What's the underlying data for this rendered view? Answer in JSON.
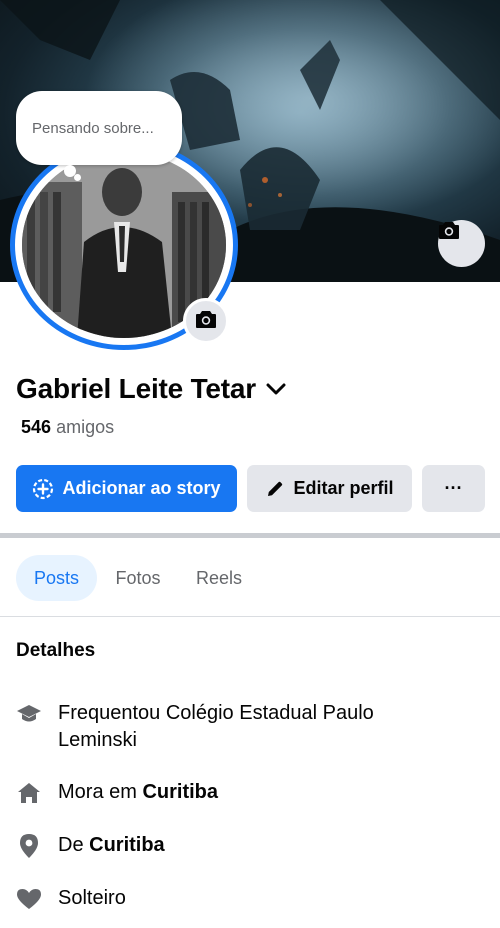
{
  "cover": {
    "camera_icon": "camera-icon"
  },
  "avatar": {
    "camera_icon": "camera-icon"
  },
  "bubble": {
    "text": "Pensando sobre..."
  },
  "profile": {
    "name": "Gabriel Leite Tetar",
    "friends_count": "546",
    "friends_label": "amigos"
  },
  "actions": {
    "add_story": "Adicionar ao story",
    "edit_profile": "Editar perfil",
    "more": "···"
  },
  "tabs": [
    {
      "label": "Posts",
      "active": true
    },
    {
      "label": "Fotos",
      "active": false
    },
    {
      "label": "Reels",
      "active": false
    }
  ],
  "details": {
    "title": "Detalhes",
    "items": [
      {
        "icon": "graduation-cap-icon",
        "text": "Frequentou Colégio Estadual Paulo Leminski",
        "bold": ""
      },
      {
        "icon": "home-icon",
        "text": "Mora em ",
        "bold": "Curitiba"
      },
      {
        "icon": "location-pin-icon",
        "text": "De ",
        "bold": "Curitiba"
      },
      {
        "icon": "heart-icon",
        "text": "Solteiro",
        "bold": ""
      }
    ]
  },
  "colors": {
    "accent": "#1877f2",
    "tab_active_bg": "#e7f3ff",
    "button_gray": "#e4e6eb"
  }
}
